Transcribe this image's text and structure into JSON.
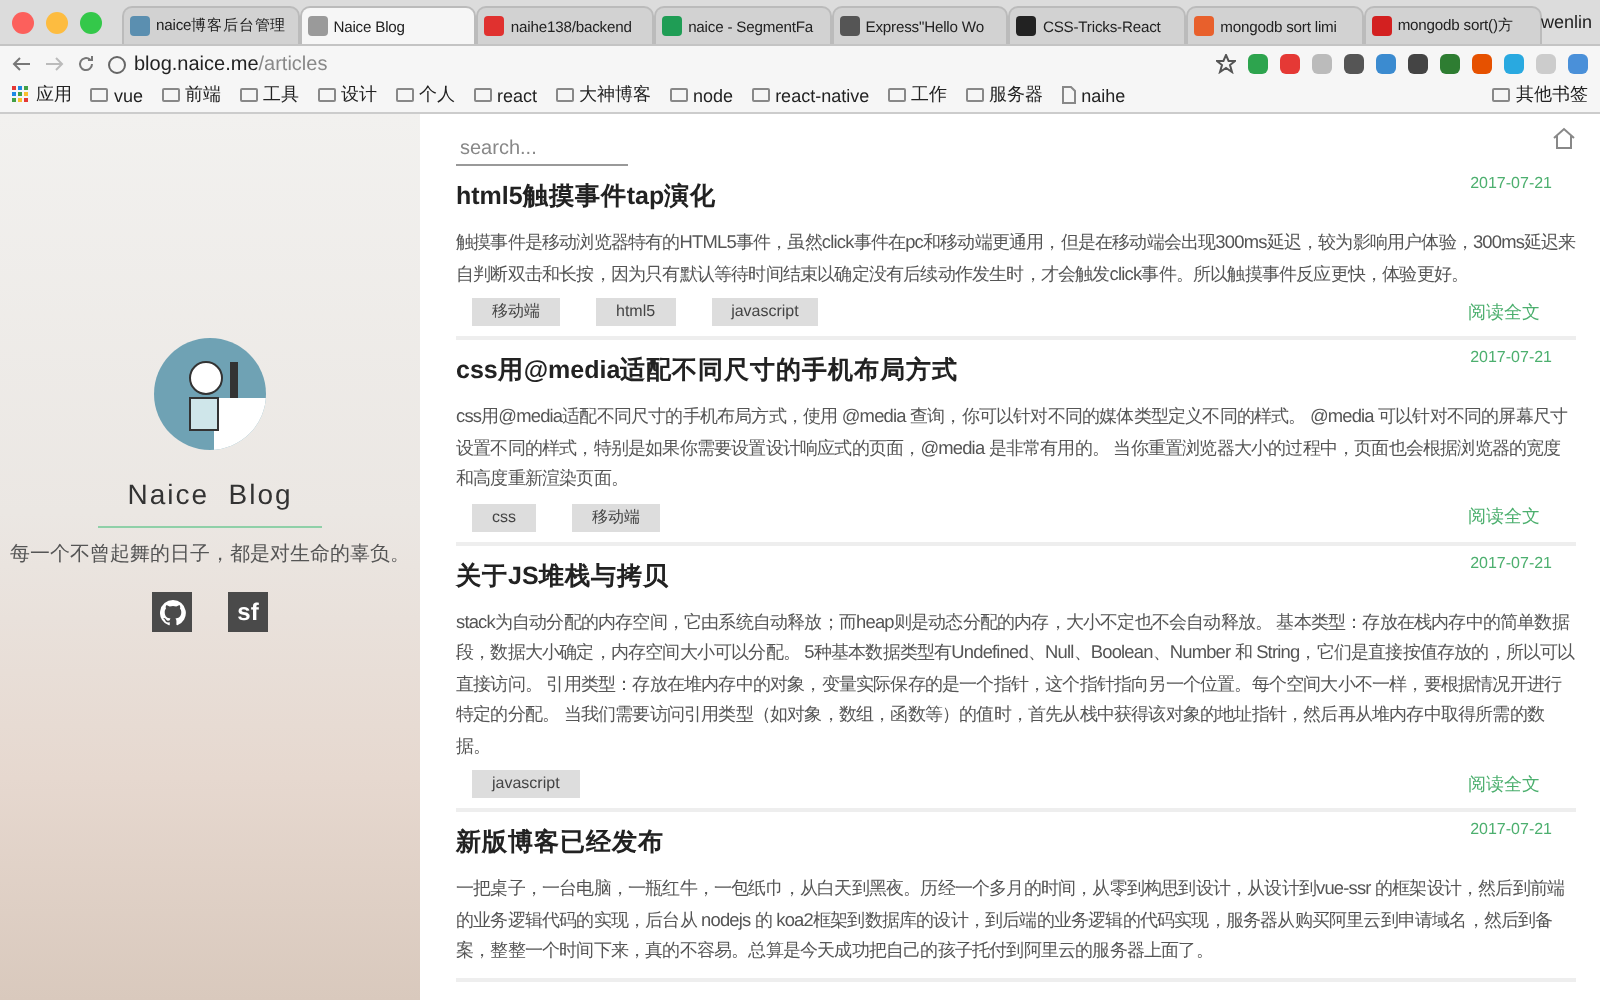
{
  "browser": {
    "tabs": [
      {
        "title": "naice博客后台管理",
        "selected": false,
        "color": "#5b8fb0"
      },
      {
        "title": "Naice Blog",
        "selected": true,
        "color": "#9a9a9a"
      },
      {
        "title": "naihe138/backend",
        "selected": false,
        "color": "#e0312f"
      },
      {
        "title": "naice - SegmentFa",
        "selected": false,
        "color": "#1f9d55"
      },
      {
        "title": "Express\"Hello Wo",
        "selected": false,
        "color": "#555555"
      },
      {
        "title": "CSS-Tricks-React",
        "selected": false,
        "color": "#222222"
      },
      {
        "title": "mongodb sort limi",
        "selected": false,
        "color": "#e8602c"
      },
      {
        "title": "mongodb sort()方",
        "selected": false,
        "color": "#d32020"
      }
    ],
    "user": "wenlin",
    "url": {
      "host": "blog.naice.me",
      "path": "/articles"
    },
    "bookmarks": [
      {
        "label": "应用",
        "kind": "apps"
      },
      {
        "label": "vue",
        "kind": "folder"
      },
      {
        "label": "前端",
        "kind": "folder"
      },
      {
        "label": "工具",
        "kind": "folder"
      },
      {
        "label": "设计",
        "kind": "folder"
      },
      {
        "label": "个人",
        "kind": "folder"
      },
      {
        "label": "react",
        "kind": "folder"
      },
      {
        "label": "大神博客",
        "kind": "folder"
      },
      {
        "label": "node",
        "kind": "folder"
      },
      {
        "label": "react-native",
        "kind": "folder"
      },
      {
        "label": "工作",
        "kind": "folder"
      },
      {
        "label": "服务器",
        "kind": "folder"
      },
      {
        "label": "naihe",
        "kind": "page"
      }
    ],
    "other_bookmarks": "其他书签"
  },
  "sidebar": {
    "blog_name": "Naice  Blog",
    "motto": "每一个不曾起舞的日子，都是对生命的辜负。",
    "social": [
      {
        "kind": "github"
      },
      {
        "kind": "text",
        "label": "sf"
      }
    ]
  },
  "main": {
    "search": {
      "placeholder": "search..."
    },
    "articles": [
      {
        "title": "html5触摸事件tap演化",
        "date": "2017-07-21",
        "excerpt": "触摸事件是移动浏览器特有的HTML5事件，虽然click事件在pc和移动端更通用，但是在移动端会出现300ms延迟，较为影响用户体验，300ms延迟来自判断双击和长按，因为只有默认等待时间结束以确定没有后续动作发生时，才会触发click事件。所以触摸事件反应更快，体验更好。",
        "tags": [
          "移动端",
          "html5",
          "javascript"
        ],
        "read_more": "阅读全文"
      },
      {
        "title": "css用@media适配不同尺寸的手机布局方式",
        "date": "2017-07-21",
        "excerpt": "css用@media适配不同尺寸的手机布局方式，使用 @media 查询，你可以针对不同的媒体类型定义不同的样式。 @media 可以针对不同的屏幕尺寸设置不同的样式，特别是如果你需要设置设计响应式的页面，@media 是非常有用的。 当你重置浏览器大小的过程中，页面也会根据浏览器的宽度和高度重新渲染页面。",
        "tags": [
          "css",
          "移动端"
        ],
        "read_more": "阅读全文"
      },
      {
        "title": "关于JS堆栈与拷贝",
        "date": "2017-07-21",
        "excerpt": "stack为自动分配的内存空间，它由系统自动释放；而heap则是动态分配的内存，大小不定也不会自动释放。 基本类型：存放在栈内存中的简单数据段，数据大小确定，内存空间大小可以分配。 5种基本数据类型有Undefined、Null、Boolean、Number 和 String，它们是直接按值存放的，所以可以直接访问。 引用类型：存放在堆内存中的对象，变量实际保存的是一个指针，这个指针指向另一个位置。每个空间大小不一样，要根据情况开进行特定的分配。 当我们需要访问引用类型（如对象，数组，函数等）的值时，首先从栈中获得该对象的地址指针，然后再从堆内存中取得所需的数据。",
        "tags": [
          "javascript"
        ],
        "read_more": "阅读全文"
      },
      {
        "title": "新版博客已经发布",
        "date": "2017-07-21",
        "excerpt": "一把桌子，一台电脑，一瓶红牛，一包纸巾，从白天到黑夜。历经一个多月的时间，从零到构思到设计，从设计到vue-ssr 的框架设计，然后到前端的业务逻辑代码的实现，后台从 nodejs 的 koa2框架到数据库的设计，到后端的业务逻辑的代码实现，服务器从购买阿里云到申请域名，然后到备案，整整一个时间下来，真的不容易。总算是今天成功把自己的孩子托付到阿里云的服务器上面了。"
      }
    ]
  }
}
